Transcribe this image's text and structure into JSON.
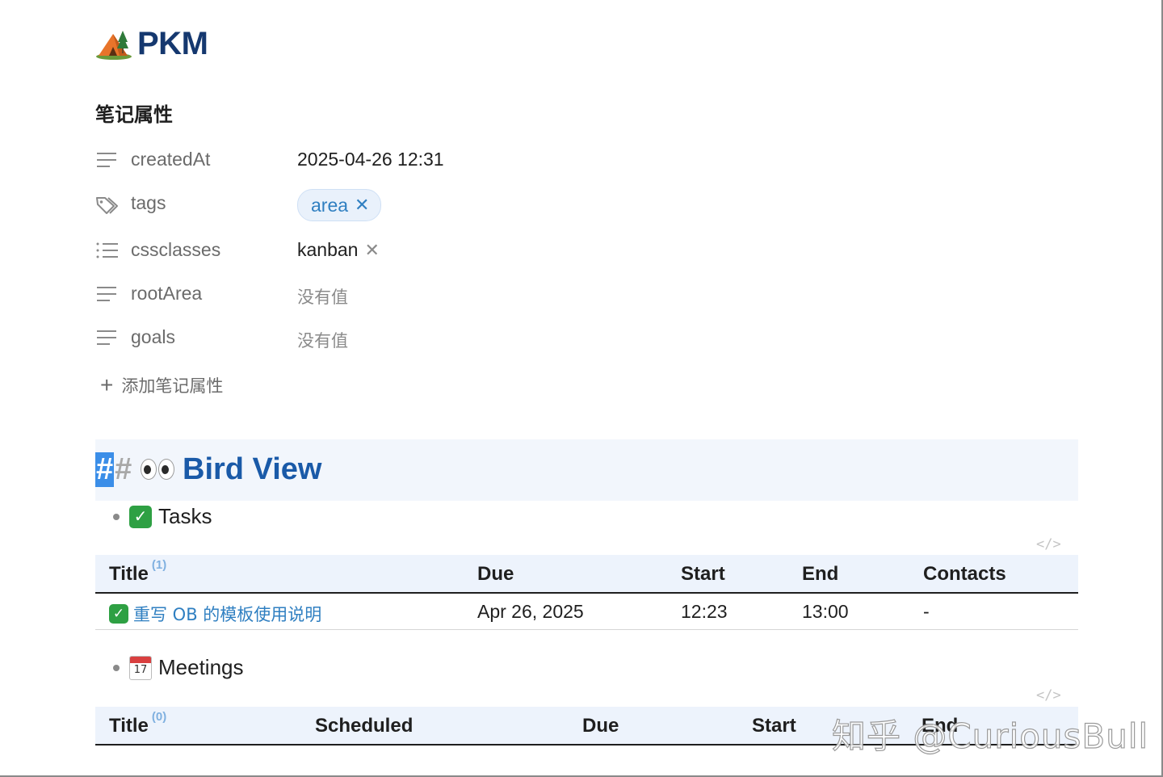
{
  "page": {
    "icon": "camping-tent-icon",
    "title": "PKM"
  },
  "properties": {
    "heading": "笔记属性",
    "items": [
      {
        "icon": "text-lines-icon",
        "key": "createdAt",
        "value": "2025-04-26 12:31"
      },
      {
        "icon": "tag-icon",
        "key": "tags",
        "value": "area",
        "remove": "✕"
      },
      {
        "icon": "list-icon",
        "key": "cssclasses",
        "value": "kanban",
        "remove": "✕"
      },
      {
        "icon": "text-lines-icon",
        "key": "rootArea",
        "value": "没有值"
      },
      {
        "icon": "text-lines-icon",
        "key": "goals",
        "value": "没有值"
      }
    ],
    "add_label": "添加笔记属性",
    "add_icon": "+"
  },
  "section": {
    "hash_selected": "#",
    "hash": "#",
    "icon": "eyes-icon",
    "heading": "Bird View"
  },
  "tasks": {
    "icon": "check-mark-icon",
    "check_glyph": "✓",
    "label": "Tasks",
    "code_tag": "</>",
    "columns": [
      "Title",
      "Due",
      "Start",
      "End",
      "Contacts"
    ],
    "count": "(1)",
    "rows": [
      {
        "title": "重写 OB 的模板使用说明",
        "due": "Apr 26, 2025",
        "start": "12:23",
        "end": "13:00",
        "contacts": "-"
      }
    ]
  },
  "meetings": {
    "icon": "calendar-icon",
    "calendar_day": "17",
    "label": "Meetings",
    "code_tag": "</>",
    "columns": [
      "Title",
      "Scheduled",
      "Due",
      "Start",
      "End"
    ],
    "count": "(0)"
  },
  "watermark": "知乎 @CuriousBull",
  "colors": {
    "title": "#15386f",
    "heading_link": "#1a5aa8",
    "link": "#2f7fc1",
    "table_header_bg": "#edf3fc",
    "heading_band_bg": "#f2f6fc",
    "selection": "#3b8ee8",
    "check_green": "#2ea043"
  }
}
